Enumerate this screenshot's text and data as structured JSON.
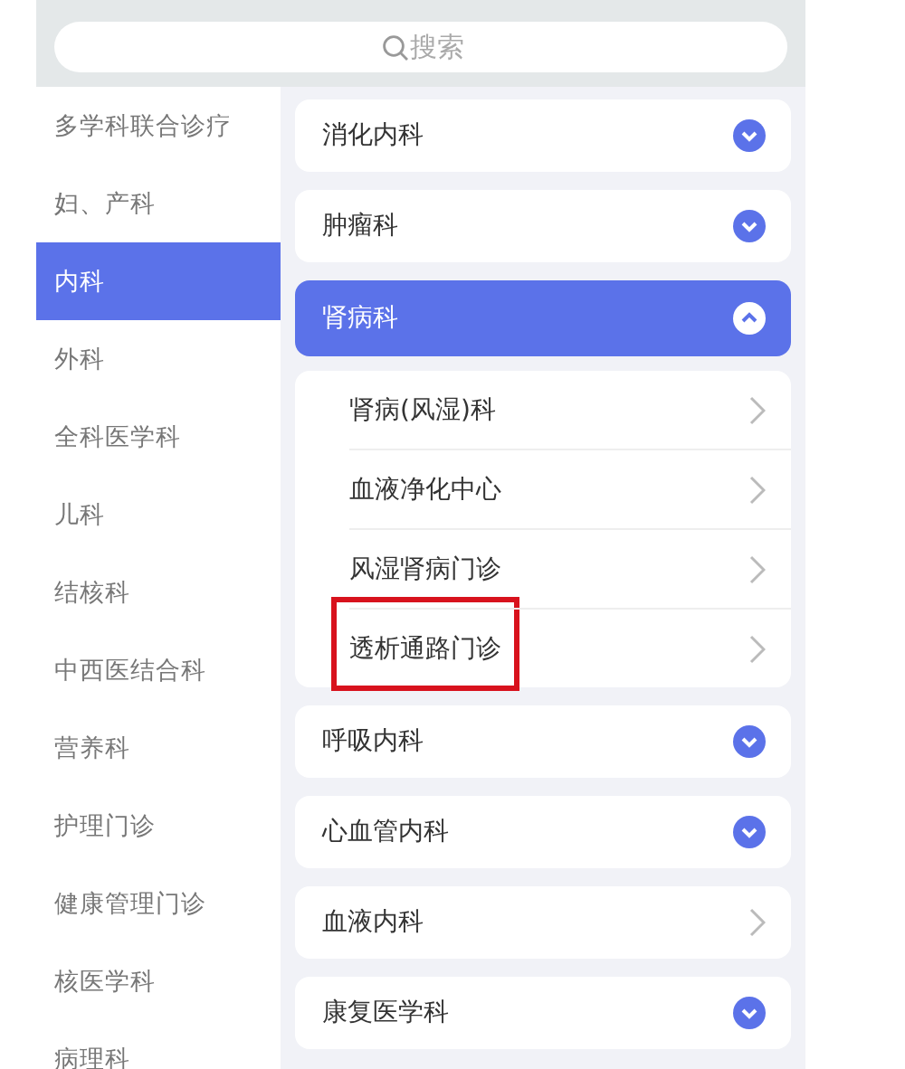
{
  "search": {
    "placeholder": "搜索"
  },
  "sidebar": {
    "items": [
      {
        "label": "多学科联合诊疗",
        "selected": false
      },
      {
        "label": "妇、产科",
        "selected": false
      },
      {
        "label": "内科",
        "selected": true
      },
      {
        "label": "外科",
        "selected": false
      },
      {
        "label": "全科医学科",
        "selected": false
      },
      {
        "label": "儿科",
        "selected": false
      },
      {
        "label": "结核科",
        "selected": false
      },
      {
        "label": "中西医结合科",
        "selected": false
      },
      {
        "label": "营养科",
        "selected": false
      },
      {
        "label": "护理门诊",
        "selected": false
      },
      {
        "label": "健康管理门诊",
        "selected": false
      },
      {
        "label": "核医学科",
        "selected": false
      },
      {
        "label": "病理科",
        "selected": false
      }
    ]
  },
  "departments": [
    {
      "label": "消化内科",
      "kind": "group",
      "expanded": false
    },
    {
      "label": "肿瘤科",
      "kind": "group",
      "expanded": false
    },
    {
      "label": "肾病科",
      "kind": "group",
      "expanded": true,
      "children": [
        {
          "label": "肾病(风湿)科",
          "highlighted": false
        },
        {
          "label": "血液净化中心",
          "highlighted": false
        },
        {
          "label": "风湿肾病门诊",
          "highlighted": false
        },
        {
          "label": "透析通路门诊",
          "highlighted": true
        }
      ]
    },
    {
      "label": "呼吸内科",
      "kind": "group",
      "expanded": false
    },
    {
      "label": "心血管内科",
      "kind": "group",
      "expanded": false
    },
    {
      "label": "血液内科",
      "kind": "link",
      "expanded": false
    },
    {
      "label": "康复医学科",
      "kind": "group",
      "expanded": false
    }
  ]
}
